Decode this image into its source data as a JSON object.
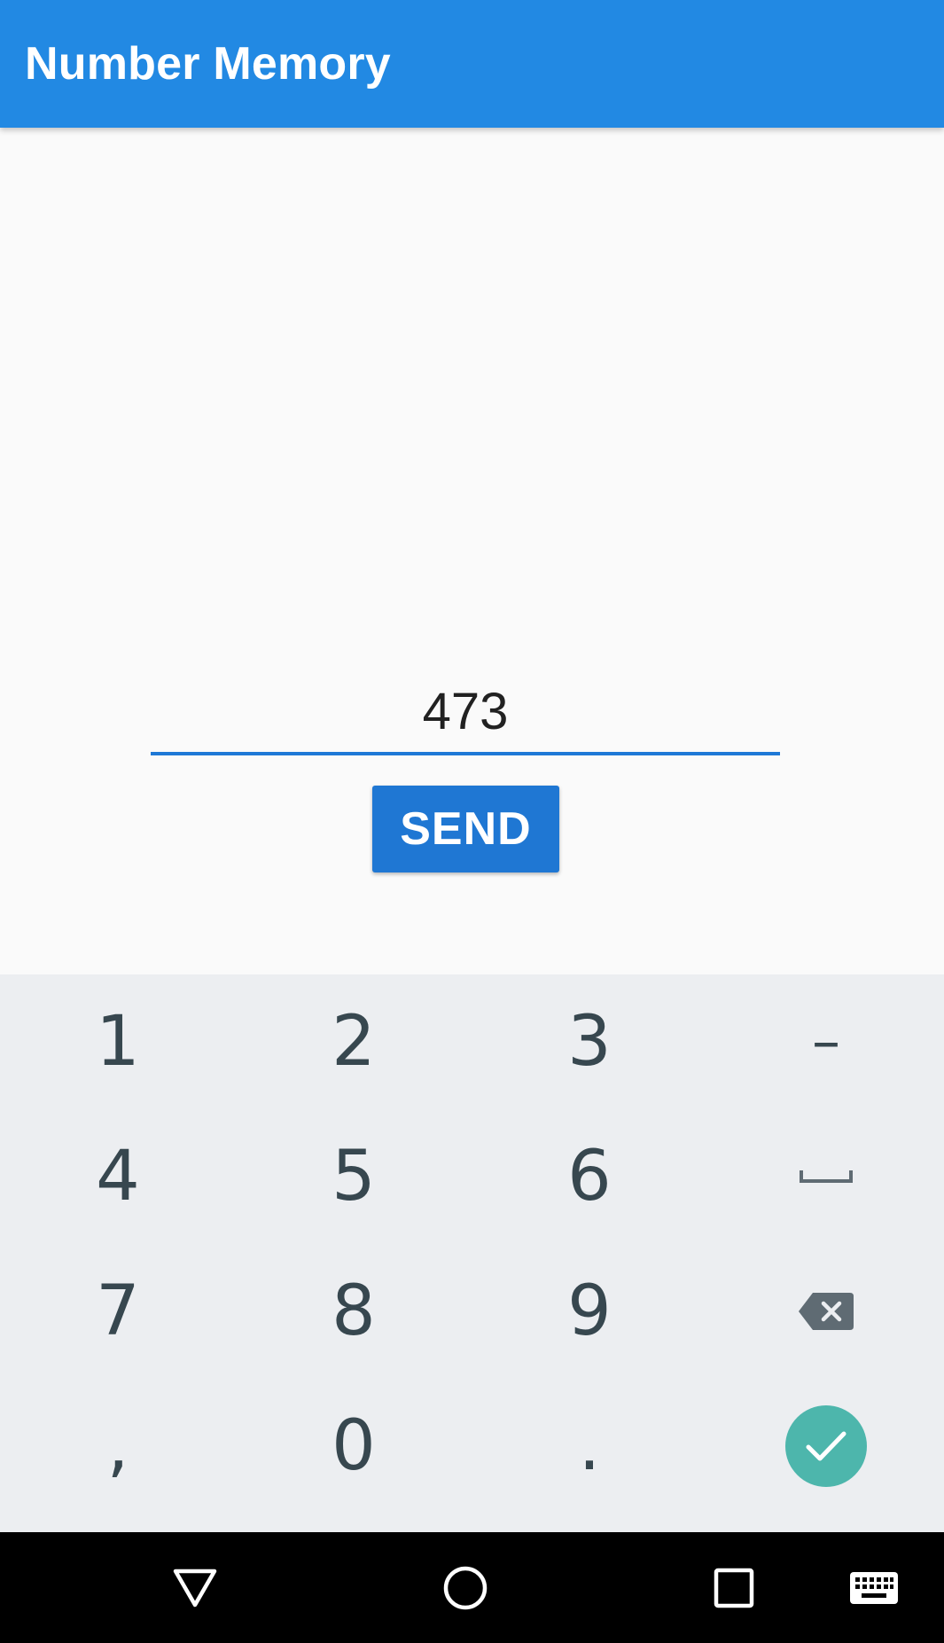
{
  "app_bar": {
    "title": "Number Memory",
    "color": "#2289e3"
  },
  "main": {
    "input_value": "473",
    "send_label": "SEND",
    "accent_color": "#1f77d3"
  },
  "keyboard": {
    "rows": [
      [
        "1",
        "2",
        "3",
        "–"
      ],
      [
        "4",
        "5",
        "6",
        "space-icon"
      ],
      [
        "7",
        "8",
        "9",
        "backspace-icon"
      ],
      [
        ",",
        "0",
        ".",
        "check-icon"
      ]
    ],
    "done_color": "#4db6ac"
  },
  "nav_bar": {
    "icons": [
      "back-triangle-icon",
      "home-circle-icon",
      "recents-square-icon",
      "keyboard-icon"
    ]
  }
}
